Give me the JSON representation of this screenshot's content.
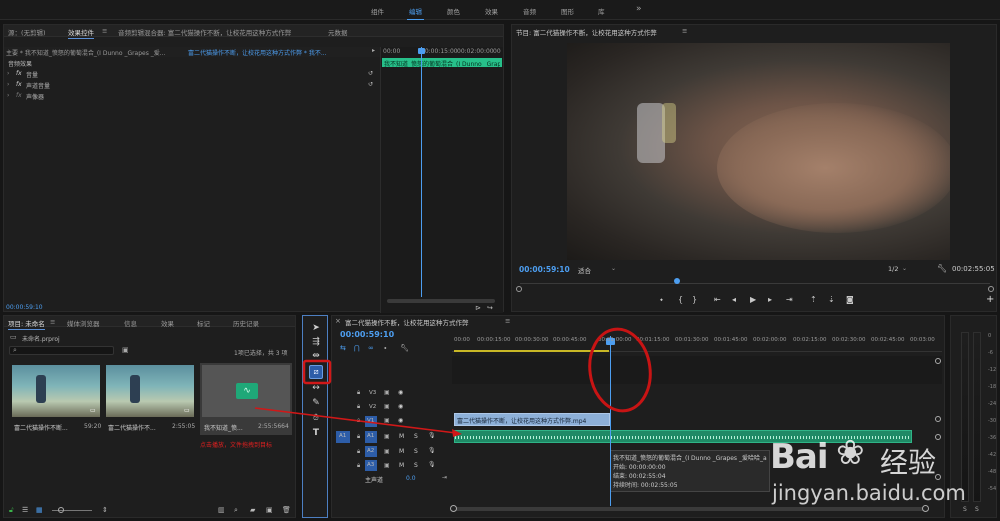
{
  "workspace_tabs": [
    "组件",
    "编辑",
    "颜色",
    "效果",
    "音频",
    "图形",
    "库"
  ],
  "workspace_active": "编辑",
  "workspace_more": "»",
  "source_panel": {
    "tabs": [
      "源：(无剪辑)",
      "效果控件",
      "音频剪辑混合器: 富二代猫操作不断，让校花用这种方式作弊",
      "元数据"
    ],
    "master_label": "主要 * 我不知道_愤怒的葡萄混合_(I Dunno _Grapes _爱...",
    "sequence_label": "富二代猫操作不断，让校花用这种方式作弊 * 我不...",
    "time_ruler": [
      "00:00",
      "00:00:15:00",
      "00:02:00:00",
      "00"
    ],
    "audio_effects_header": "音频效果",
    "effects": [
      {
        "fx": "fx",
        "name": "音量"
      },
      {
        "fx": "fx",
        "name": "声道音量"
      },
      {
        "fx": "fx",
        "name": "声像器"
      }
    ],
    "clip_name": "我不知道_愤怒的葡萄混合_(I Dunno _Grapes",
    "timecode": "00:00:59:10"
  },
  "program_monitor": {
    "title": "节目: 富二代猫操作不断，让校花用这种方式作弊",
    "timecode": "00:00:59:10",
    "fit": "适合",
    "fraction": "1/2",
    "duration": "00:02:55:05",
    "controls": [
      "marker-icon",
      "in-icon",
      "out-icon",
      "go-in-icon",
      "step-back-icon",
      "play-icon",
      "step-forward-icon",
      "go-out-icon",
      "lift-icon",
      "extract-icon",
      "export-frame-icon"
    ],
    "add": "+"
  },
  "project_panel": {
    "tabs": [
      "项目: 未命名",
      "媒体浏览器",
      "信息",
      "效果",
      "标记",
      "历史记录"
    ],
    "project_file": "未命名.prproj",
    "selection_info": "1项已选择，共 3 项",
    "items": [
      {
        "name": "富二代猫操作不断...",
        "duration": "59:20"
      },
      {
        "name": "富二代猫操作不...",
        "duration": "2:55:05"
      },
      {
        "name": "我不知道_愤...",
        "duration": "2:55:5664"
      }
    ],
    "annotation": "点击播放，文件拖拽到目标"
  },
  "tools": [
    "selection-tool-icon",
    "track-select-icon",
    "ripple-edit-icon",
    "razor-tool-icon",
    "slip-tool-icon",
    "pen-tool-icon",
    "hand-tool-icon",
    "type-tool-icon"
  ],
  "timeline": {
    "title": "富二代猫操作不断，让校花用这种方式作弊",
    "timecode": "00:00:59:10",
    "ruler": [
      "00:00",
      "00:00:15:00",
      "00:00:30:00",
      "00:00:45:00",
      "00:01:00:00",
      "00:01:15:00",
      "00:01:30:00",
      "00:01:45:00",
      "00:02:00:00",
      "00:02:15:00",
      "00:02:30:00",
      "00:02:45:00",
      "00:03:00"
    ],
    "video_tracks": [
      "V3",
      "V2",
      "V1"
    ],
    "audio_tracks": [
      "A1",
      "A2",
      "A3"
    ],
    "source_v": "V1",
    "source_a": "A1",
    "master": "主声道",
    "master_value": "0.0",
    "video_clip": "富二代猫操作不断，让校花用这种方式作弊.mp4",
    "tooltip": {
      "name": "我不知道_愤怒的葡萄混合_(I Dunno _Grapes _爱哈哈_a",
      "start": "开始: 00:00:00:00",
      "end": "结束: 00:02:55:04",
      "duration": "持续时间: 00:02:55:05"
    }
  },
  "meter": {
    "labels": [
      "0",
      "-6",
      "-12",
      "-18",
      "-24",
      "-30",
      "-36",
      "-42",
      "-48",
      "-54"
    ],
    "footer": [
      "S",
      "S"
    ]
  },
  "watermark": {
    "brand": "Bai",
    "icon": "paw-icon",
    "tail": "经验",
    "url": "jingyan.baidu.com"
  },
  "colors": {
    "accent": "#4d9ef0",
    "audio_clip": "#1f8a66",
    "marker": "#d01818",
    "video_clip": "#8db0d8"
  }
}
